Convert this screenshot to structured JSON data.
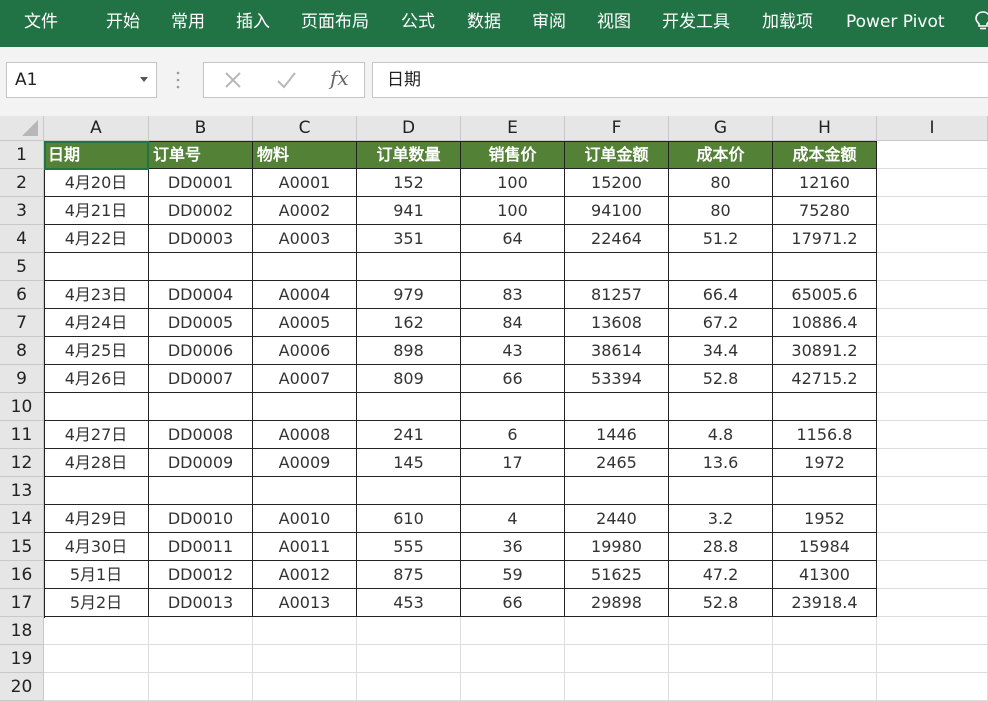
{
  "ribbon": {
    "tabs": [
      "文件",
      "开始",
      "常用",
      "插入",
      "页面布局",
      "公式",
      "数据",
      "审阅",
      "视图",
      "开发工具",
      "加载项",
      "Power Pivot"
    ]
  },
  "formula_bar": {
    "name_box": "A1",
    "fx_label": "fx",
    "content": "日期"
  },
  "icons": [
    "dropdown-arrow-icon",
    "more-dots-icon",
    "cancel-icon",
    "enter-check-icon",
    "fx-icon",
    "lightbulb-icon"
  ],
  "colors": {
    "ribbon": "#217346",
    "table_header": "#538135"
  },
  "sheet": {
    "columns": [
      "A",
      "B",
      "C",
      "D",
      "E",
      "F",
      "G",
      "H",
      "I"
    ],
    "row_numbers": [
      "1",
      "2",
      "3",
      "4",
      "5",
      "6",
      "7",
      "8",
      "9",
      "10",
      "11",
      "12",
      "13",
      "14",
      "15",
      "16",
      "17",
      "18",
      "19",
      "20"
    ],
    "header": [
      "日期",
      "订单号",
      "物料",
      "订单数量",
      "销售价",
      "订单金额",
      "成本价",
      "成本金额"
    ],
    "rows": [
      [
        "4月20日",
        "DD0001",
        "A0001",
        "152",
        "100",
        "15200",
        "80",
        "12160"
      ],
      [
        "4月21日",
        "DD0002",
        "A0002",
        "941",
        "100",
        "94100",
        "80",
        "75280"
      ],
      [
        "4月22日",
        "DD0003",
        "A0003",
        "351",
        "64",
        "22464",
        "51.2",
        "17971.2"
      ],
      [
        "",
        "",
        "",
        "",
        "",
        "",
        "",
        ""
      ],
      [
        "4月23日",
        "DD0004",
        "A0004",
        "979",
        "83",
        "81257",
        "66.4",
        "65005.6"
      ],
      [
        "4月24日",
        "DD0005",
        "A0005",
        "162",
        "84",
        "13608",
        "67.2",
        "10886.4"
      ],
      [
        "4月25日",
        "DD0006",
        "A0006",
        "898",
        "43",
        "38614",
        "34.4",
        "30891.2"
      ],
      [
        "4月26日",
        "DD0007",
        "A0007",
        "809",
        "66",
        "53394",
        "52.8",
        "42715.2"
      ],
      [
        "",
        "",
        "",
        "",
        "",
        "",
        "",
        ""
      ],
      [
        "4月27日",
        "DD0008",
        "A0008",
        "241",
        "6",
        "1446",
        "4.8",
        "1156.8"
      ],
      [
        "4月28日",
        "DD0009",
        "A0009",
        "145",
        "17",
        "2465",
        "13.6",
        "1972"
      ],
      [
        "",
        "",
        "",
        "",
        "",
        "",
        "",
        ""
      ],
      [
        "4月29日",
        "DD0010",
        "A0010",
        "610",
        "4",
        "2440",
        "3.2",
        "1952"
      ],
      [
        "4月30日",
        "DD0011",
        "A0011",
        "555",
        "36",
        "19980",
        "28.8",
        "15984"
      ],
      [
        "5月1日",
        "DD0012",
        "A0012",
        "875",
        "59",
        "51625",
        "47.2",
        "41300"
      ],
      [
        "5月2日",
        "DD0013",
        "A0013",
        "453",
        "66",
        "29898",
        "52.8",
        "23918.4"
      ]
    ]
  }
}
